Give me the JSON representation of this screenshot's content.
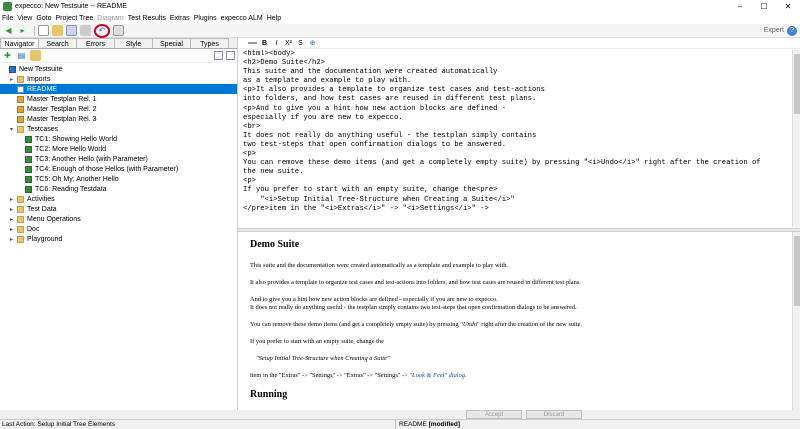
{
  "window": {
    "title": "expecco: New Testsuite -- README"
  },
  "menu": [
    "File",
    "View",
    "Goto",
    "Project Tree",
    "Diagram",
    "Test Results",
    "Extras",
    "Plugins",
    "expecco ALM",
    "Help"
  ],
  "toolbar": {
    "mode_label": "Expert"
  },
  "navigator": {
    "tabs": [
      "Navigator",
      "Search",
      "Errors",
      "Style",
      "Special",
      "Types"
    ],
    "tree": [
      {
        "label": "New Testsuite",
        "icon": "suite-icon",
        "depth": 0
      },
      {
        "label": "Imports",
        "icon": "folder-icon",
        "depth": 1
      },
      {
        "label": "README",
        "icon": "document-icon",
        "depth": 1
      },
      {
        "label": "Master Testplan Rel. 1",
        "icon": "testplan-icon",
        "depth": 1
      },
      {
        "label": "Master Testplan Rel. 2",
        "icon": "testplan-icon",
        "depth": 1
      },
      {
        "label": "Master Testplan Rel. 3",
        "icon": "testplan-icon",
        "depth": 1
      },
      {
        "label": "Testcases",
        "icon": "folder-icon",
        "depth": 1
      },
      {
        "label": "TC1: Showing Hello World",
        "icon": "testcase-icon",
        "depth": 2
      },
      {
        "label": "TC2: More Hello World",
        "icon": "testcase-icon",
        "depth": 2
      },
      {
        "label": "TC3: Another Hello (with Parameter)",
        "icon": "testcase-icon",
        "depth": 2
      },
      {
        "label": "TC4: Enough of those Hellos (with Parameter)",
        "icon": "testcase-icon",
        "depth": 2
      },
      {
        "label": "TC5: Oh My; Another Hello",
        "icon": "testcase-icon",
        "depth": 2
      },
      {
        "label": "TC6: Reading Testdata",
        "icon": "testcase-icon",
        "depth": 2
      },
      {
        "label": "Activities",
        "icon": "folder-icon",
        "depth": 1
      },
      {
        "label": "Test Data",
        "icon": "folder-icon",
        "depth": 1
      },
      {
        "label": "Menu Operations",
        "icon": "folder-icon",
        "depth": 1
      },
      {
        "label": "Doc",
        "icon": "folder-icon",
        "depth": 1
      },
      {
        "label": "Playground",
        "icon": "folder-icon",
        "depth": 1
      }
    ],
    "selected": "README"
  },
  "editor": {
    "source_lines": [
      "<html><body>",
      "<h2>Demo Suite</h2>",
      "This suite and the documentation were created automatically",
      "as a template and example to play with.",
      "<p>It also provides a template to organize test cases and test-actions",
      "into folders, and how test cases are reused in different test plans.",
      "<p>And to give you a hint how new action blocks are defined -",
      "especially if you are new to expecco.",
      "<br>",
      "It does not really do anything useful - the testplan simply contains",
      "two test-steps that open confirmation dialogs to be answered.",
      "<p>",
      "You can remove these demo items (and get a completely empty suite) by pressing \"<i>Undo</i>\" right after the creation of",
      "the new suite.",
      "<p>",
      "If you prefer to start with an empty suite, change the<pre>",
      "    \"<i>Setup Initial Tree-Structure when Creating a Suite</i>\"",
      "</pre>item in the \"<i>Extras</i>\" -> \"<i>Settings</i>\" ->"
    ],
    "preview": {
      "heading": "Demo Suite",
      "p1": "This suite and the documentation were created automatically as a template and example to play with.",
      "p2": "It also provides a template to organize test cases and test-actions into folders, and how test cases are reused in different test plans.",
      "p3a": "And to give you a hint how new action blocks are defined - especially if you are new to expecco.",
      "p3b": "It does not really do anything useful - the testplan simply contains two test-steps that open confirmation dialogs to be answered.",
      "p4_pre": "You can remove these demo items (and get a completely empty suite) by pressing \"",
      "p4_em": "Undo",
      "p4_post": "\" right after the creation of the new suite.",
      "p5": "If you prefer to start with an empty suite, change the",
      "p6": "\"Setup Initial Tree-Structure when Creating a Suite\"",
      "p7_pre": "item in the \"Extras\" -> \"Settings\" -> \"Extras\" -> \"Settings\" -> ",
      "p7_link": "\"Look & Feel\" dialog.",
      "heading2": "Running"
    }
  },
  "buttons": {
    "accept": "Accept",
    "discard": "Discard"
  },
  "status": {
    "last_action": "Last Action: Setup Initial Tree Elements",
    "doc_name": "README",
    "doc_state": "[modified]"
  }
}
